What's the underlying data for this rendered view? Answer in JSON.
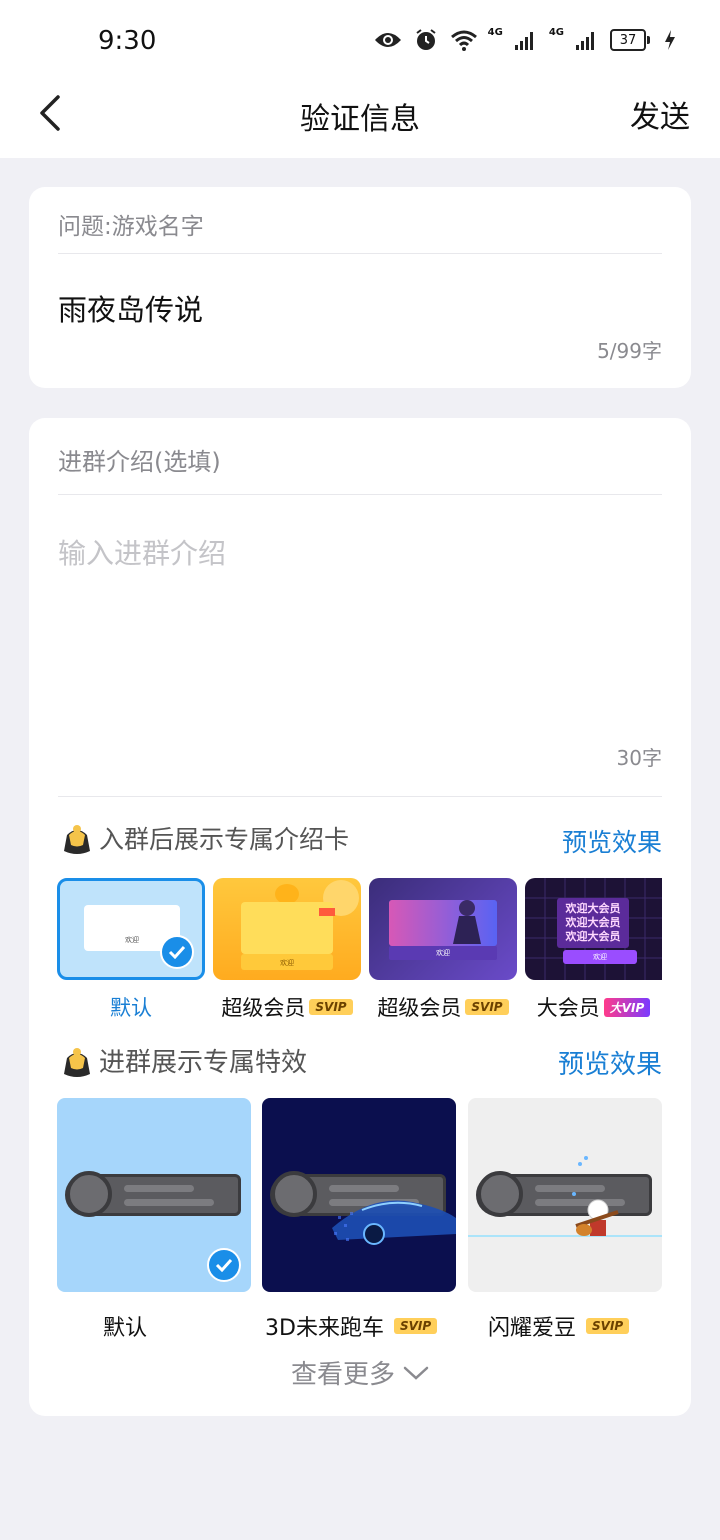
{
  "status_bar": {
    "time": "9:30",
    "net1": "4G",
    "net2": "4G",
    "battery": "37"
  },
  "header": {
    "title": "验证信息",
    "send_label": "发送"
  },
  "question_card": {
    "label": "问题:游戏名字",
    "answer": "雨夜岛传说",
    "count": "5/99字"
  },
  "intro_card": {
    "label": "进群介绍(选填)",
    "placeholder": "输入进群介绍",
    "count": "30字"
  },
  "intro_templates": {
    "title": "入群后展示专属介绍卡",
    "preview_label": "预览效果",
    "items": [
      {
        "label": "默认",
        "badge": "",
        "card_text": "欢迎",
        "selected": true
      },
      {
        "label": "超级会员",
        "badge": "SVIP",
        "card_text": "欢迎"
      },
      {
        "label": "超级会员",
        "badge": "SVIP",
        "card_text": "欢迎"
      },
      {
        "label": "大会员",
        "badge": "大VIP",
        "card_text": "欢迎大会员",
        "button_text": "欢迎"
      }
    ]
  },
  "entry_effects": {
    "title": "进群展示专属特效",
    "preview_label": "预览效果",
    "items": [
      {
        "label": "默认",
        "badge": "",
        "selected": true
      },
      {
        "label": "3D未来跑车",
        "badge": "SVIP"
      },
      {
        "label": "闪耀爱豆",
        "badge": "SVIP"
      }
    ]
  },
  "more_label": "查看更多",
  "colors": {
    "accent": "#1a7fd4",
    "check": "#1a8ee8",
    "background": "#f0f0f5"
  }
}
